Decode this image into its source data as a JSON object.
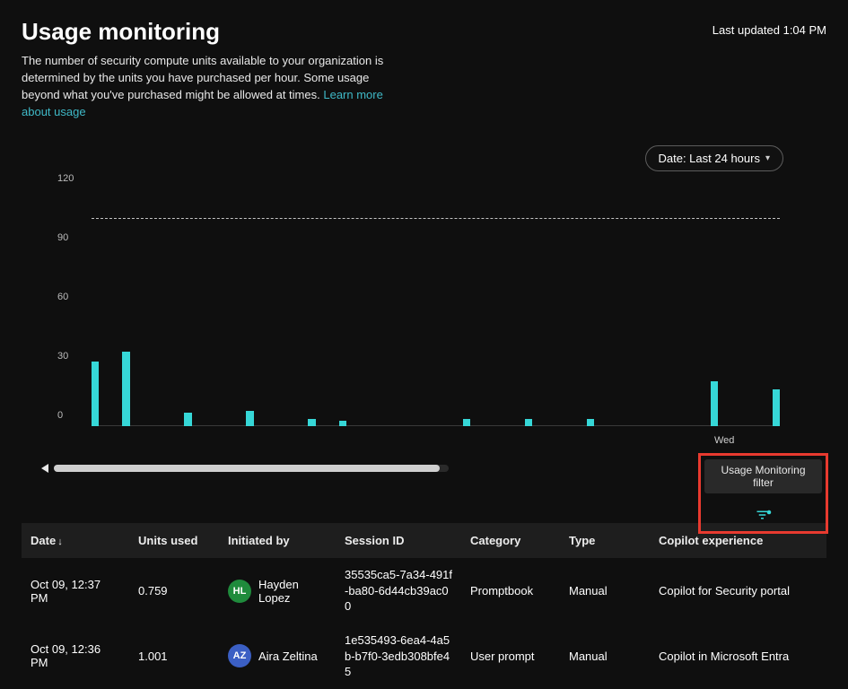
{
  "header": {
    "title": "Usage monitoring",
    "last_updated": "Last updated 1:04 PM",
    "description": "The number of security compute units available to your organization is determined by the units you have purchased per hour. Some usage beyond what you've purchased might be allowed at times.",
    "learn_more": "Learn more about usage"
  },
  "filter_pill": {
    "label": "Date: Last 24 hours"
  },
  "callout": {
    "tooltip": "Usage Monitoring filter"
  },
  "chart_data": {
    "type": "bar",
    "ylabel": "",
    "ylim": [
      0,
      120
    ],
    "y_ticks": [
      0,
      30,
      60,
      90,
      120
    ],
    "reference_line": 105,
    "x_tick_label": "Wed",
    "x_tick_index": 20,
    "values": [
      33,
      38,
      0,
      7,
      0,
      8,
      0,
      4,
      3,
      0,
      0,
      0,
      4,
      0,
      4,
      0,
      4,
      0,
      0,
      0,
      23,
      0,
      19
    ]
  },
  "table": {
    "columns": [
      "Date",
      "Units used",
      "Initiated by",
      "Session ID",
      "Category",
      "Type",
      "Copilot experience"
    ],
    "sort_column": 0,
    "sort_dir": "down",
    "rows": [
      {
        "date": "Oct 09, 12:37 PM",
        "units": "0.759",
        "user": {
          "initials": "HL",
          "name": "Hayden Lopez",
          "color": "#1f8b3c"
        },
        "session": "35535ca5-7a34-491f-ba80-6d44cb39ac00",
        "category": "Promptbook",
        "type": "Manual",
        "experience": "Copilot for Security portal"
      },
      {
        "date": "Oct 09, 12:36 PM",
        "units": "1.001",
        "user": {
          "initials": "AZ",
          "name": "Aira Zeltina",
          "color": "#3b5fc4"
        },
        "session": "1e535493-6ea4-4a5b-b7f0-3edb308bfe45",
        "category": "User prompt",
        "type": "Manual",
        "experience": "Copilot in Microsoft Entra"
      }
    ]
  }
}
